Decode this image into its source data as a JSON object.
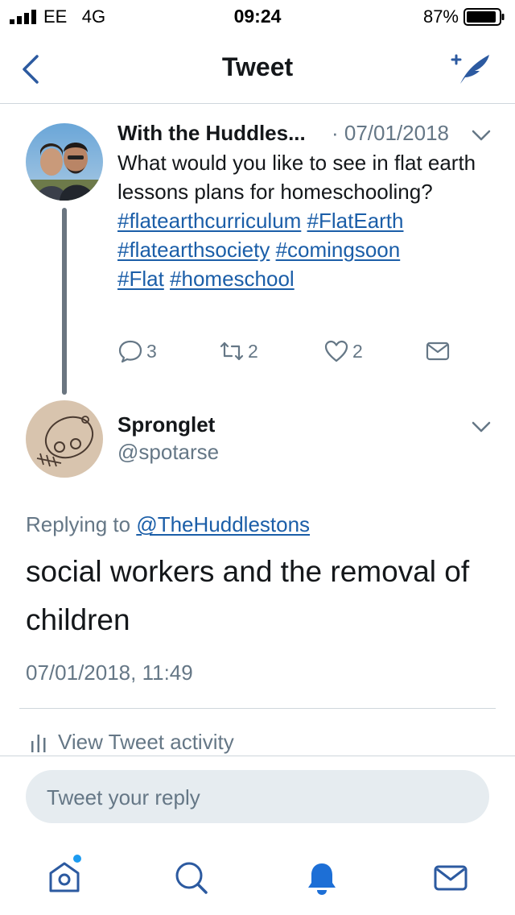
{
  "status_bar": {
    "carrier": "EE",
    "network": "4G",
    "time": "09:24",
    "battery": "87%"
  },
  "nav": {
    "title": "Tweet",
    "back_icon": "chevron-left-icon",
    "compose_icon": "compose-tweet-icon"
  },
  "original_tweet": {
    "author_name": "With the Huddles...",
    "date": "· 07/01/2018",
    "text": "What would you like to see in flat earth lessons plans for homeschooling?",
    "hashtags": [
      "#flatearthcurriculum",
      "#FlatEarth",
      "#flatearthsociety",
      "#comingsoon",
      "#Flat",
      "#homeschool"
    ],
    "replies": "3",
    "retweets": "2",
    "likes": "2"
  },
  "reply_tweet": {
    "author_name": "Spronglet",
    "handle": "@spotarse",
    "replying_to_label": "Replying to",
    "replying_to": "@TheHuddlestons",
    "text": "social workers and the removal of children",
    "timestamp": "07/01/2018, 11:49"
  },
  "activity_label": "View Tweet activity",
  "reply_input": {
    "placeholder": "Tweet your reply"
  },
  "tabs": [
    {
      "icon": "home-icon",
      "has_notification_dot": true
    },
    {
      "icon": "search-icon"
    },
    {
      "icon": "notifications-bell-icon",
      "active": true
    },
    {
      "icon": "messages-envelope-icon"
    }
  ],
  "colors": {
    "accent": "#1da1f2",
    "link": "#1b5ea8",
    "nav_blue": "#2c5aa0",
    "text": "#14171a",
    "secondary": "#657786",
    "input_bg": "#e6ecf0"
  }
}
